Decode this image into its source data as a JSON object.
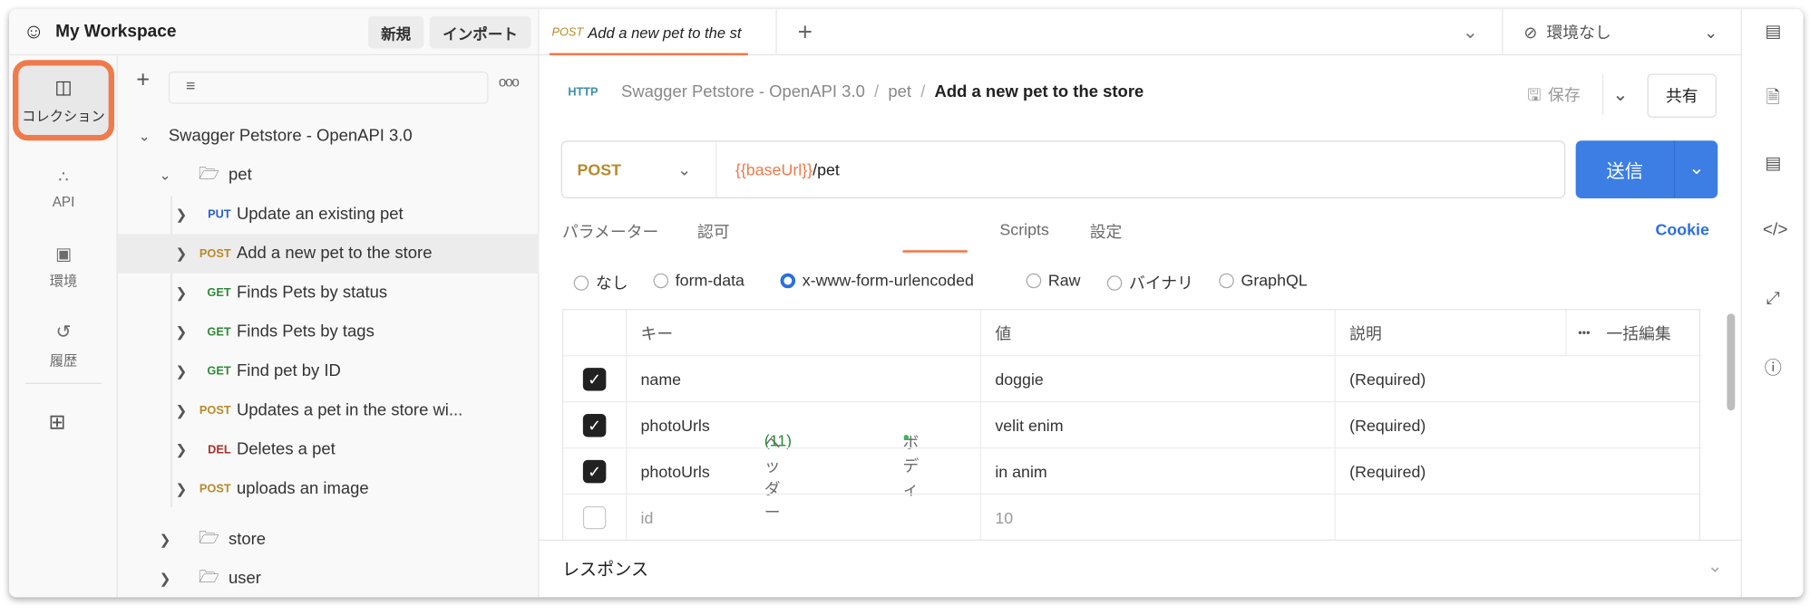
{
  "workspace": {
    "name": "My Workspace",
    "new_label": "新規",
    "import_label": "インポート"
  },
  "rail": [
    {
      "label": "コレクション"
    },
    {
      "label": "API"
    },
    {
      "label": "環境"
    },
    {
      "label": "履歴"
    }
  ],
  "tree": {
    "collection": "Swagger Petstore - OpenAPI 3.0",
    "folder": "pet",
    "requests": [
      {
        "method": "PUT",
        "name": "Update an existing pet",
        "color": "#2b5fc7"
      },
      {
        "method": "POST",
        "name": "Add a new pet to the store",
        "color": "#b78a2a"
      },
      {
        "method": "GET",
        "name": "Finds Pets by status",
        "color": "#2f8a3a"
      },
      {
        "method": "GET",
        "name": "Finds Pets by tags",
        "color": "#2f8a3a"
      },
      {
        "method": "GET",
        "name": "Find pet by ID",
        "color": "#2f8a3a"
      },
      {
        "method": "POST",
        "name": "Updates a pet in the store wi...",
        "color": "#b78a2a"
      },
      {
        "method": "DEL",
        "name": "Deletes a pet",
        "color": "#a5302a"
      },
      {
        "method": "POST",
        "name": "uploads an image",
        "color": "#b78a2a"
      }
    ],
    "folders": [
      "store",
      "user"
    ]
  },
  "tab": {
    "method": "POST",
    "title": "Add a new pet to the st"
  },
  "env": {
    "label": "環境なし"
  },
  "breadcrumb": {
    "collection": "Swagger Petstore - OpenAPI 3.0",
    "folder": "pet",
    "request": "Add a new pet to the store",
    "save": "保存",
    "share": "共有"
  },
  "request": {
    "method": "POST",
    "url_var": "{{baseUrl}}",
    "url_path": "/pet",
    "send": "送信"
  },
  "subtabs": {
    "params": "パラメーター",
    "auth": "認可",
    "headers": "ヘッダー",
    "headers_count": "(11)",
    "body": "ボディ",
    "scripts": "Scripts",
    "settings": "設定",
    "cookie": "Cookie"
  },
  "body_types": [
    "なし",
    "form-data",
    "x-www-form-urlencoded",
    "Raw",
    "バイナリ",
    "GraphQL"
  ],
  "table": {
    "headers": {
      "key": "キー",
      "value": "値",
      "desc": "説明",
      "bulk": "一括編集"
    },
    "rows": [
      {
        "checked": true,
        "key": "name",
        "value": "doggie",
        "desc": "(Required)"
      },
      {
        "checked": true,
        "key": "photoUrls",
        "value": "velit enim",
        "desc": "(Required)"
      },
      {
        "checked": true,
        "key": "photoUrls",
        "value": "in anim",
        "desc": "(Required)"
      },
      {
        "checked": false,
        "key": "id",
        "value": "10",
        "desc": ""
      }
    ]
  },
  "response": {
    "label": "レスポンス"
  }
}
